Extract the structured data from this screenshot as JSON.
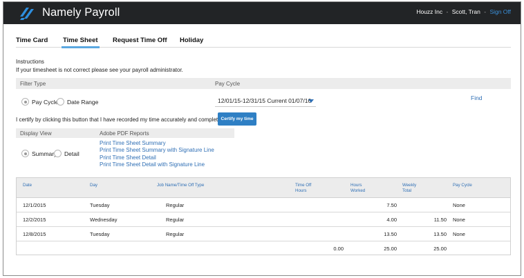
{
  "app": {
    "brand": "Namely Payroll"
  },
  "header": {
    "company": "Houzz Inc",
    "separator": "-",
    "user": "Scott, Tran",
    "sign_off": "Sign Off"
  },
  "tabs": [
    {
      "label": "Time Card",
      "active": false
    },
    {
      "label": "Time Sheet",
      "active": true
    },
    {
      "label": "Request Time Off",
      "active": false
    },
    {
      "label": "Holiday",
      "active": false
    }
  ],
  "instructions": {
    "title": "Instructions",
    "text": "If your timesheet is not correct please see your payroll administrator."
  },
  "filter": {
    "filter_type_label": "Filter Type",
    "pay_cycle_label": "Pay Cycle",
    "options": [
      {
        "label": "Pay Cycle",
        "selected": true
      },
      {
        "label": "Date Range",
        "selected": false
      }
    ],
    "pay_cycle_value": "12/01/15-12/31/15 Current 01/07/16",
    "find_label": "Find"
  },
  "certify": {
    "text": "I certify by clicking this button that I have recorded my time accurately and completely",
    "button_label": "Certify my time"
  },
  "display": {
    "display_view_label": "Display View",
    "reports_label": "Adobe PDF Reports",
    "options": [
      {
        "label": "Summary",
        "selected": true
      },
      {
        "label": "Detail",
        "selected": false
      }
    ],
    "report_links": [
      "Print Time Sheet Summary",
      "Print Time Sheet Summary with Signature Line",
      "Print Time Sheet Detail",
      "Print Time Sheet Detail with Signature Line"
    ]
  },
  "table": {
    "headers": {
      "date": "Date",
      "day": "Day",
      "job": "Job Name/Time Off Type",
      "timeoff_1": "Time Off",
      "timeoff_2": "Hours",
      "worked_1": "Hours",
      "worked_2": "Worked",
      "weekly_1": "Weekly",
      "weekly_2": "Total",
      "pay_cycle": "Pay Cycle"
    },
    "rows": [
      {
        "date": "12/1/2015",
        "day": "Tuesday",
        "job": "Regular",
        "time_off": "",
        "worked": "7.50",
        "weekly": "",
        "pay_cycle": "None"
      },
      {
        "date": "12/2/2015",
        "day": "Wednesday",
        "job": "Regular",
        "time_off": "",
        "worked": "4.00",
        "weekly": "11.50",
        "pay_cycle": "None"
      },
      {
        "date": "12/8/2015",
        "day": "Tuesday",
        "job": "Regular",
        "time_off": "",
        "worked": "13.50",
        "weekly": "13.50",
        "pay_cycle": "None"
      }
    ],
    "totals": {
      "time_off": "0.00",
      "worked": "25.00",
      "weekly": "25.00"
    }
  },
  "colors": {
    "header_bg": "#222426",
    "accent": "#2f6fb5",
    "tab_underline": "#5aa7e0",
    "button": "#2e7fc4"
  }
}
